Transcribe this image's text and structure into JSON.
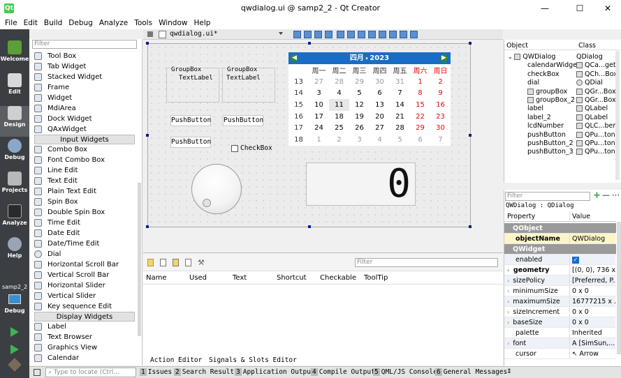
{
  "window": {
    "title": "qwdialog.ui @ samp2_2 - Qt Creator",
    "app_icon": "qt-icon",
    "minimize": "—",
    "maximize": "☐",
    "close": "✕"
  },
  "menu": [
    "File",
    "Edit",
    "Build",
    "Debug",
    "Analyze",
    "Tools",
    "Window",
    "Help"
  ],
  "modes": [
    {
      "label": "Welcome",
      "icon": "welcome-icon"
    },
    {
      "label": "Edit",
      "icon": "edit-icon"
    },
    {
      "label": "Design",
      "icon": "design-icon"
    },
    {
      "label": "Debug",
      "icon": "debug-icon"
    },
    {
      "label": "Projects",
      "icon": "projects-icon"
    },
    {
      "label": "Analyze",
      "icon": "analyze-icon"
    },
    {
      "label": "Help",
      "icon": "help-icon"
    }
  ],
  "kit": {
    "project": "samp2_2",
    "config": "Debug"
  },
  "editor": {
    "file_name": "qwdialog.ui*"
  },
  "widget_box": {
    "filter_placeholder": "Filter",
    "items_top": [
      "Tool Box",
      "Tab Widget",
      "Stacked Widget",
      "Frame",
      "Widget",
      "MdiArea",
      "Dock Widget",
      "QAxWidget"
    ],
    "cat_input": "Input Widgets",
    "items_input": [
      "Combo Box",
      "Font Combo Box",
      "Line Edit",
      "Text Edit",
      "Plain Text Edit",
      "Spin Box",
      "Double Spin Box",
      "Time Edit",
      "Date Edit",
      "Date/Time Edit",
      "Dial",
      "Horizontal Scroll Bar",
      "Vertical Scroll Bar",
      "Horizontal Slider",
      "Vertical Slider",
      "Key sequence Edit"
    ],
    "cat_display": "Display Widgets",
    "items_display": [
      "Label",
      "Text Browser",
      "Graphics View",
      "Calendar"
    ]
  },
  "form": {
    "groupbox1_title": "GroupBox",
    "groupbox1_label": "TextLabel",
    "groupbox2_title": "GroupBox",
    "groupbox2_label": "TextLabel",
    "pushbutton1": "PushButton",
    "pushbutton2": "PushButton",
    "pushbutton3": "PushButton",
    "checkbox": "CheckBox",
    "lcd_value": "0"
  },
  "calendar": {
    "month": "四月",
    "year": "2023",
    "weekday_headers": [
      "周一",
      "周二",
      "周三",
      "周四",
      "周五",
      "周六",
      "周日"
    ],
    "weeks": [
      {
        "wk": "13",
        "days": [
          "27",
          "28",
          "29",
          "30",
          "31",
          "1",
          "2"
        ]
      },
      {
        "wk": "14",
        "days": [
          "3",
          "4",
          "5",
          "6",
          "7",
          "8",
          "9"
        ]
      },
      {
        "wk": "15",
        "days": [
          "10",
          "11",
          "12",
          "13",
          "14",
          "15",
          "16"
        ]
      },
      {
        "wk": "16",
        "days": [
          "17",
          "18",
          "19",
          "20",
          "21",
          "22",
          "23"
        ]
      },
      {
        "wk": "17",
        "days": [
          "24",
          "25",
          "26",
          "27",
          "28",
          "29",
          "30"
        ]
      },
      {
        "wk": "18",
        "days": [
          "1",
          "2",
          "3",
          "4",
          "5",
          "6",
          "7"
        ]
      }
    ],
    "selected": "11"
  },
  "object_inspector": {
    "headers": [
      "Object",
      "Class"
    ],
    "rows": [
      {
        "o": "QWDialog",
        "c": "QDialog"
      },
      {
        "o": "calendarWidget",
        "c": "QCa...get"
      },
      {
        "o": "checkBox",
        "c": "QCh...Box"
      },
      {
        "o": "dial",
        "c": "QDial"
      },
      {
        "o": "groupBox",
        "c": "QGr...Box"
      },
      {
        "o": "groupBox_2",
        "c": "QGr...Box"
      },
      {
        "o": "label",
        "c": "QLabel"
      },
      {
        "o": "label_2",
        "c": "QLabel"
      },
      {
        "o": "lcdNumber",
        "c": "QLC...ber"
      },
      {
        "o": "pushButton",
        "c": "QPu...ton"
      },
      {
        "o": "pushButton_2",
        "c": "QPu...ton"
      },
      {
        "o": "pushButton_3",
        "c": "QPu...ton"
      }
    ]
  },
  "property_editor": {
    "filter_placeholder": "Filter",
    "add": "+",
    "remove": "—",
    "config": "⋯",
    "context": "QWDialog : QDialog",
    "headers": [
      "Property",
      "Value"
    ],
    "rows": [
      {
        "n": "QObject",
        "v": "",
        "t": "sec"
      },
      {
        "n": "objectName",
        "v": "QWDialog",
        "t": "yel"
      },
      {
        "n": "QWidget",
        "v": "",
        "t": "sec"
      },
      {
        "n": "enabled",
        "v": "✓",
        "t": "blue"
      },
      {
        "n": "geometry",
        "v": "[(0, 0), 736 x...",
        "t": "bold"
      },
      {
        "n": "sizePolicy",
        "v": "[Preferred, P...",
        "t": "blue"
      },
      {
        "n": "minimumSize",
        "v": "0 x 0",
        "t": ""
      },
      {
        "n": "maximumSize",
        "v": "16777215 x ...",
        "t": "blue"
      },
      {
        "n": "sizeIncrement",
        "v": "0 x 0",
        "t": ""
      },
      {
        "n": "baseSize",
        "v": "0 x 0",
        "t": "blue"
      },
      {
        "n": "palette",
        "v": "Inherited",
        "t": ""
      },
      {
        "n": "font",
        "v": "A [SimSun,...",
        "t": "blue"
      },
      {
        "n": "cursor",
        "v": "Arrow",
        "t": ""
      }
    ]
  },
  "action_editor": {
    "filter_placeholder": "Filter",
    "columns": [
      "Name",
      "Used",
      "Text",
      "Shortcut",
      "Checkable",
      "ToolTip"
    ],
    "tabs": [
      "Action Editor",
      "Signals & Slots Editor"
    ]
  },
  "status": {
    "locate_placeholder": "Type to locate (Ctrl...",
    "panes": [
      {
        "n": "1",
        "l": "Issues"
      },
      {
        "n": "2",
        "l": "Search Results"
      },
      {
        "n": "3",
        "l": "Application Output"
      },
      {
        "n": "4",
        "l": "Compile Output"
      },
      {
        "n": "5",
        "l": "QML/JS Console"
      },
      {
        "n": "6",
        "l": "General Messages"
      }
    ]
  }
}
